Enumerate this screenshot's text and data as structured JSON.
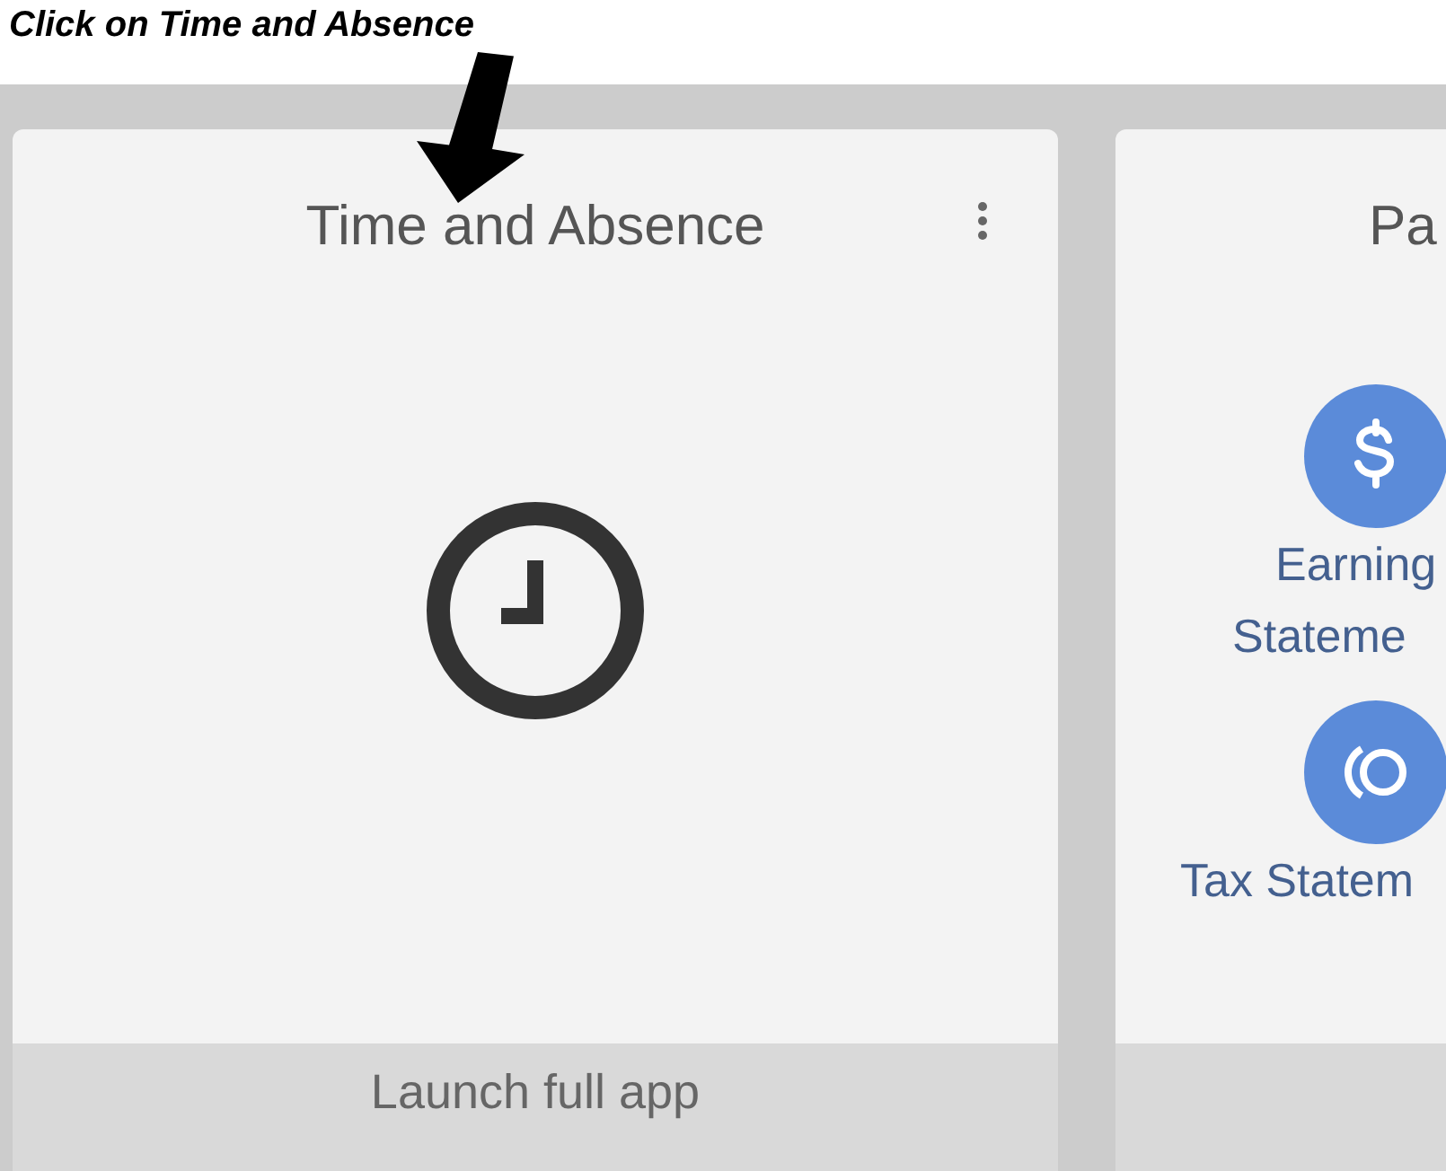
{
  "instruction": "Click on Time and Absence",
  "cards": [
    {
      "kind": "single",
      "title": "Time and Absence",
      "footer": "Launch full app"
    },
    {
      "kind": "list",
      "title": "Pa",
      "items": [
        {
          "kind": "dollar",
          "lines": [
            "Earning",
            "Stateme"
          ]
        },
        {
          "kind": "tax",
          "lines": [
            "Tax Statem"
          ]
        }
      ]
    }
  ]
}
